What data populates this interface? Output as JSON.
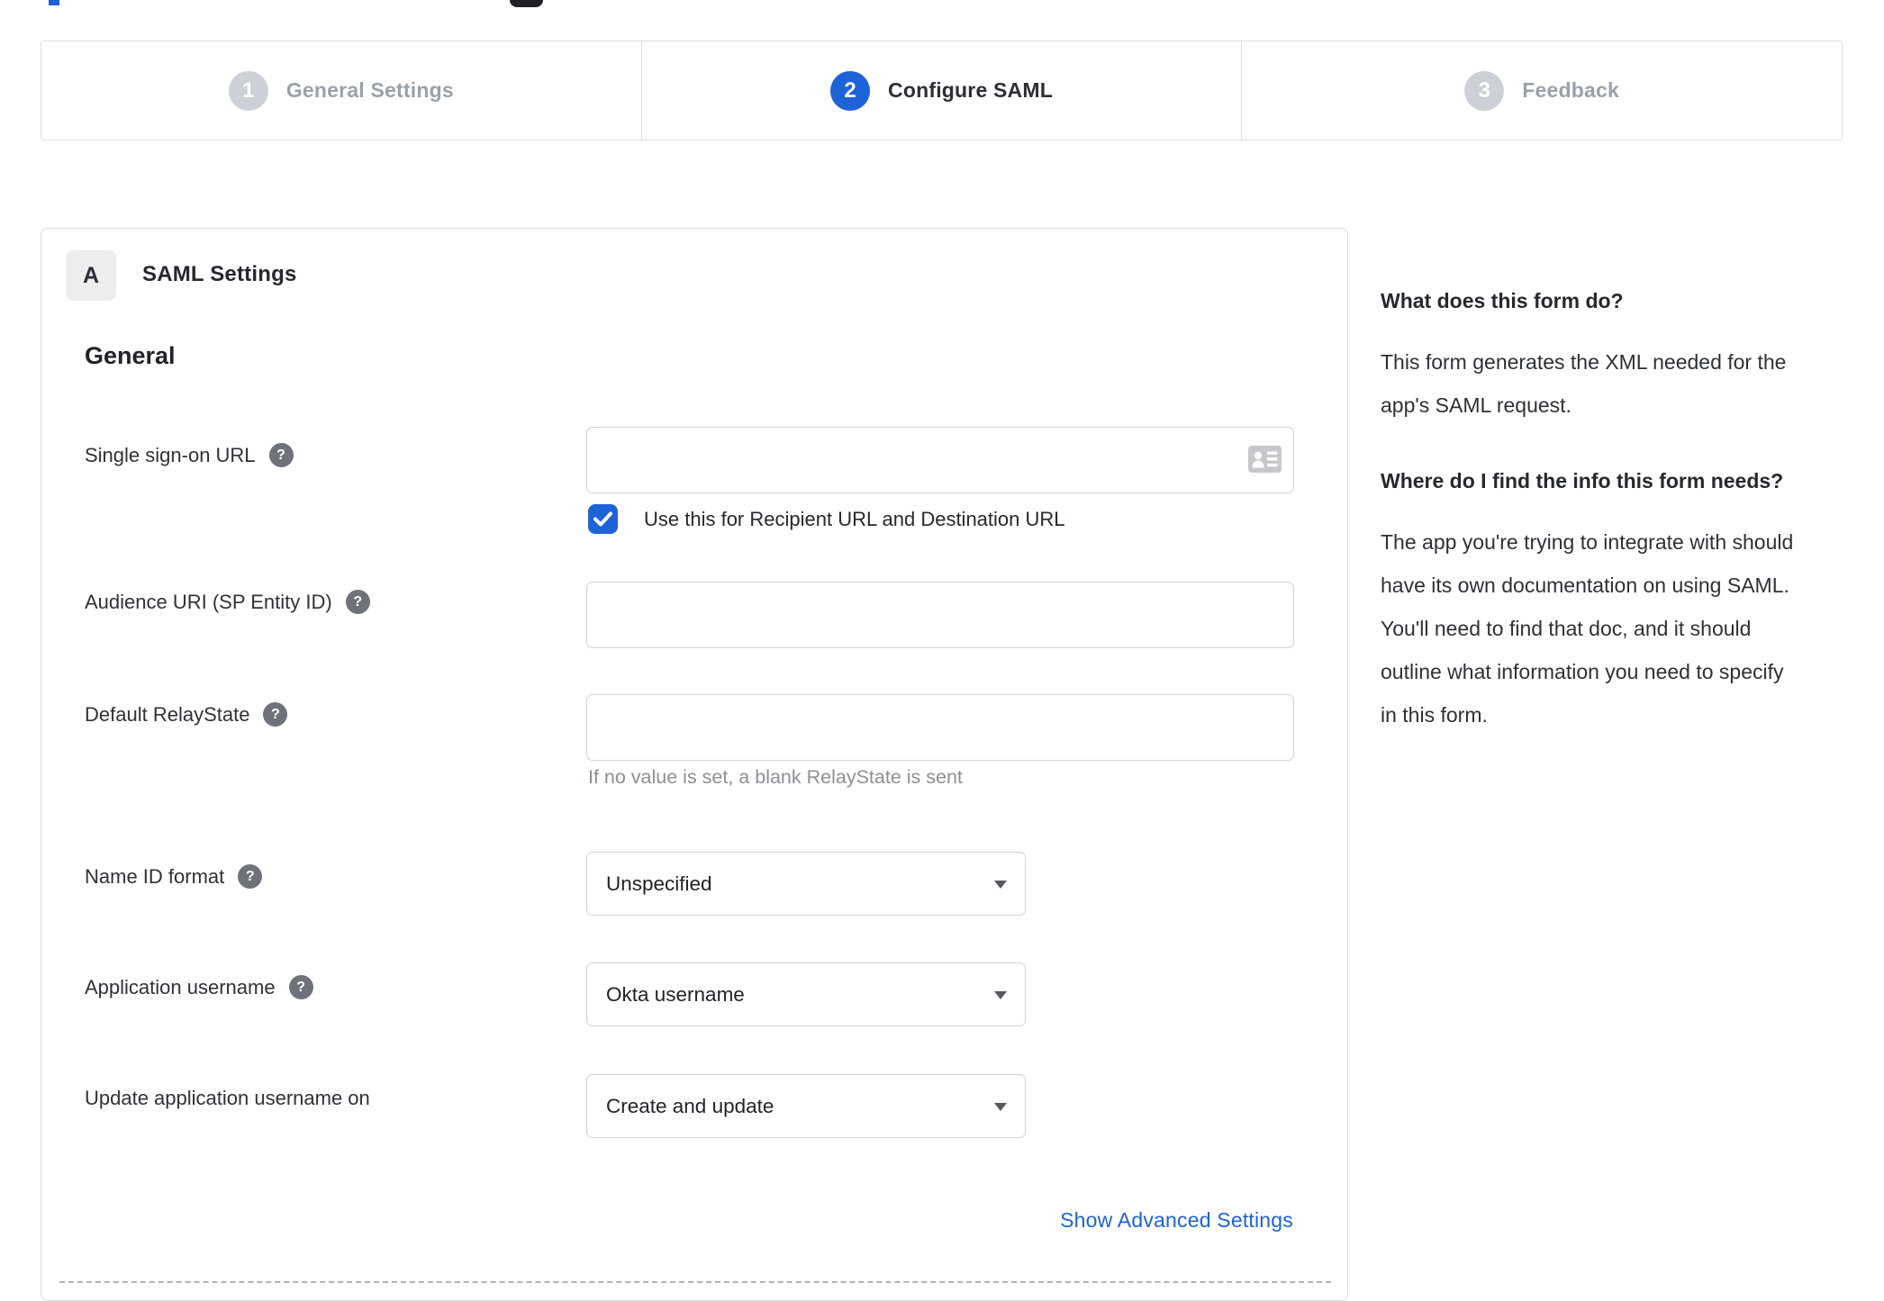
{
  "colors": {
    "accent": "#1e62d8"
  },
  "icons": {
    "help_glyph": "?"
  },
  "stepper": {
    "active_step": 2,
    "steps": [
      {
        "number": "1",
        "label": "General Settings"
      },
      {
        "number": "2",
        "label": "Configure SAML"
      },
      {
        "number": "3",
        "label": "Feedback"
      }
    ]
  },
  "form": {
    "badge": "A",
    "title": "SAML Settings",
    "section": "General",
    "sso": {
      "label": "Single sign-on URL",
      "value": "",
      "checkbox_label": "Use this for Recipient URL and Destination URL",
      "checkbox_checked": true
    },
    "audience": {
      "label": "Audience URI (SP Entity ID)",
      "value": ""
    },
    "relay": {
      "label": "Default RelayState",
      "value": "",
      "hint": "If no value is set, a blank RelayState is sent"
    },
    "name_id": {
      "label": "Name ID format",
      "value": "Unspecified"
    },
    "app_username": {
      "label": "Application username",
      "value": "Okta username"
    },
    "update_username": {
      "label": "Update application username on",
      "value": "Create and update"
    },
    "advanced_link": "Show Advanced Settings"
  },
  "help": {
    "q1_title": "What does this form do?",
    "q1_body": "This form generates the XML needed for the app's SAML request.",
    "q2_title": "Where do I find the info this form needs?",
    "q2_body": "The app you're trying to integrate with should have its own documentation on using SAML. You'll need to find that doc, and it should outline what information you need to specify in this form."
  }
}
